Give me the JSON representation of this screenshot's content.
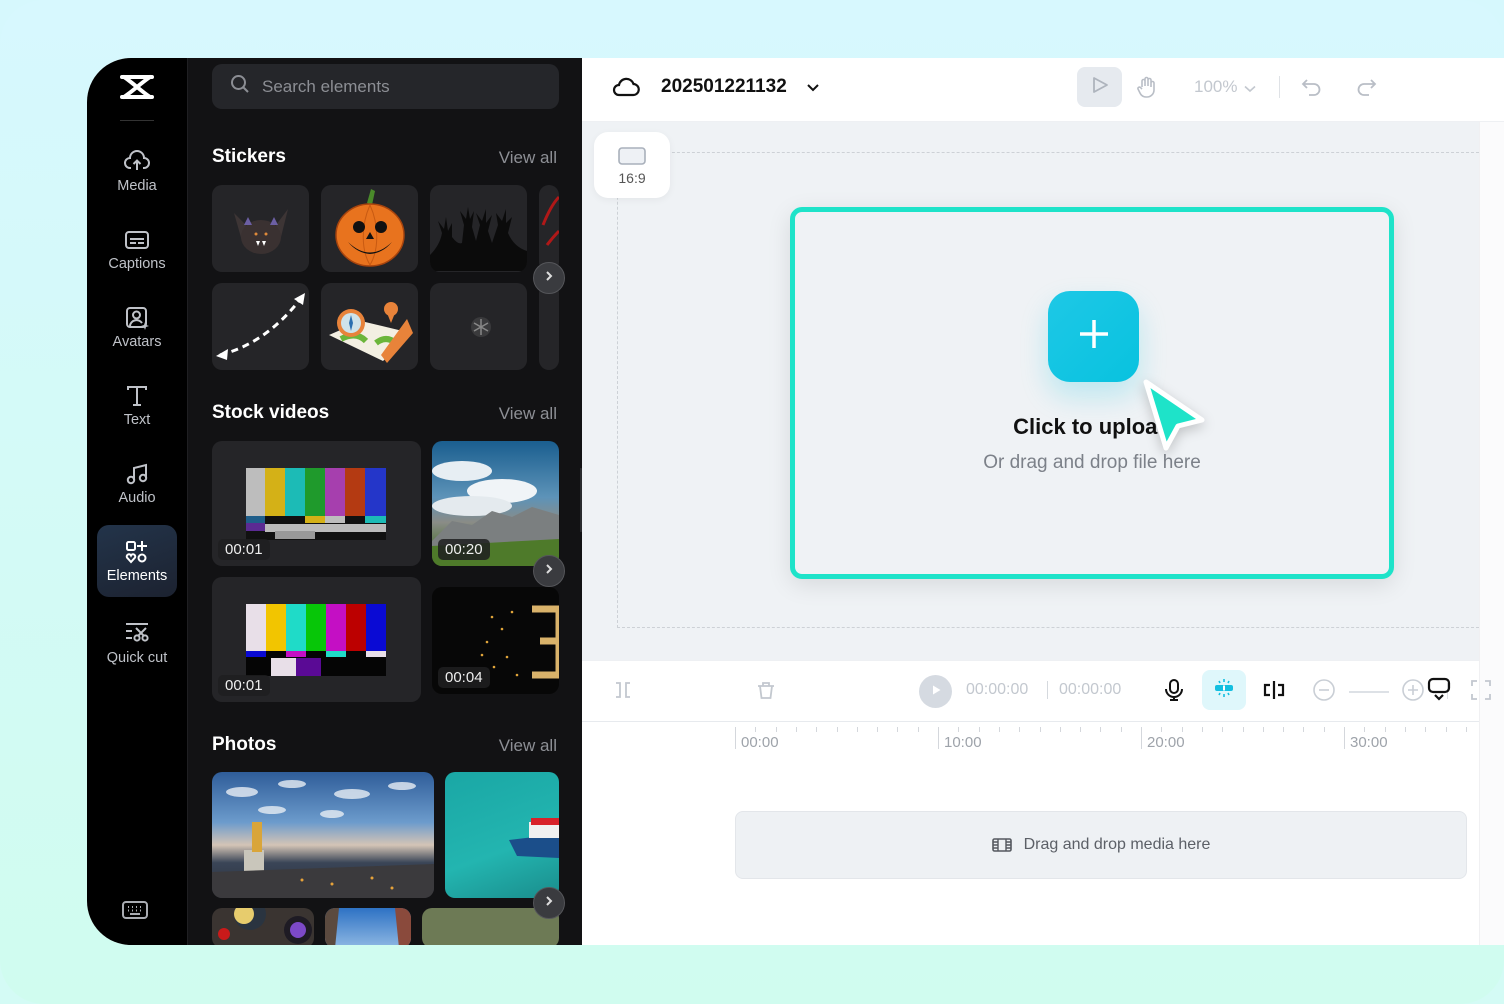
{
  "app": {
    "logo": "capcut-logo-icon",
    "project_title": "202501221132",
    "accent_color": "#1ee3c9",
    "upload_button_color": "#08c2df"
  },
  "sidebar": {
    "items": [
      {
        "label": "Media",
        "icon": "cloud-upload-icon",
        "active": false
      },
      {
        "label": "Captions",
        "icon": "captions-icon",
        "active": false
      },
      {
        "label": "Avatars",
        "icon": "avatar-icon",
        "active": false
      },
      {
        "label": "Text",
        "icon": "text-icon",
        "active": false
      },
      {
        "label": "Audio",
        "icon": "music-note-icon",
        "active": false
      },
      {
        "label": "Elements",
        "icon": "elements-icon",
        "active": true
      },
      {
        "label": "Quick cut",
        "icon": "quick-cut-icon",
        "active": false
      }
    ],
    "keyboard_icon": "keyboard-icon"
  },
  "panel": {
    "search": {
      "placeholder": "Search elements",
      "value": ""
    },
    "stickers": {
      "title": "Stickers",
      "view_all": "View all",
      "items": [
        "bat",
        "jack-o-lantern pumpkin",
        "zombie hands",
        "dashed double arrow",
        "map with compass",
        "sparkle",
        "red brush"
      ]
    },
    "stock_videos": {
      "title": "Stock videos",
      "view_all": "View all",
      "items": [
        {
          "duration": "00:01",
          "subject": "color bars test pattern"
        },
        {
          "duration": "00:20",
          "subject": "mountain landscape"
        },
        {
          "duration": "00:01",
          "subject": "color bars test pattern"
        },
        {
          "duration": "00:04",
          "subject": "sparkling number 3"
        }
      ]
    },
    "photos": {
      "title": "Photos",
      "view_all": "View all",
      "items": [
        "city skyline at dusk",
        "boat on turquoise sea",
        "food flat lay",
        "street buildings",
        "grass field"
      ]
    }
  },
  "topbar": {
    "cloud_icon": "cloud-icon",
    "zoom_level": "100%",
    "tools": [
      "select-pointer",
      "hand-pan",
      "undo",
      "redo"
    ]
  },
  "canvas": {
    "aspect_ratio": "16:9",
    "upload_title": "Click to upload",
    "upload_subtitle": "Or drag and drop file here"
  },
  "timeline": {
    "current_time": "00:00:00",
    "total_time": "00:00:00",
    "ruler_labels": [
      "00:00",
      "10:00",
      "20:00",
      "30:00"
    ],
    "drop_hint": "Drag and drop media here"
  }
}
